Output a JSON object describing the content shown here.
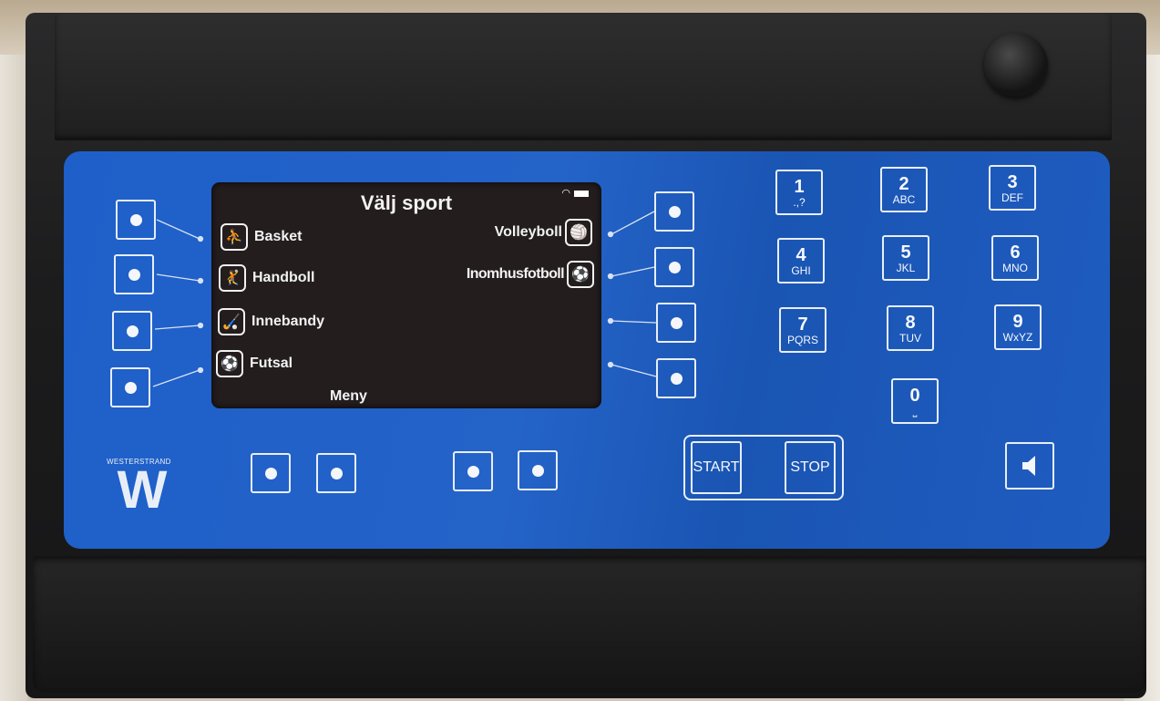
{
  "screen": {
    "title": "Välj sport",
    "left_sports": [
      {
        "label": "Basket",
        "icon": "basketball-player-icon"
      },
      {
        "label": "Handboll",
        "icon": "handball-player-icon"
      },
      {
        "label": "Innebandy",
        "icon": "floorball-player-icon"
      },
      {
        "label": "Futsal",
        "icon": "futsal-player-icon"
      }
    ],
    "right_sports": [
      {
        "label": "Volleyboll",
        "icon": "volleyball-player-icon"
      },
      {
        "label": "Inomhusfotboll",
        "icon": "indoor-football-player-icon"
      }
    ],
    "menu": "Meny"
  },
  "keypad": [
    {
      "digit": "1",
      "letters": ".,?"
    },
    {
      "digit": "2",
      "letters": "ABC"
    },
    {
      "digit": "3",
      "letters": "DEF"
    },
    {
      "digit": "4",
      "letters": "GHI"
    },
    {
      "digit": "5",
      "letters": "JKL"
    },
    {
      "digit": "6",
      "letters": "MNO"
    },
    {
      "digit": "7",
      "letters": "PQRS"
    },
    {
      "digit": "8",
      "letters": "TUV"
    },
    {
      "digit": "9",
      "letters": "WxYZ"
    },
    {
      "digit": "0",
      "letters": "⎵"
    }
  ],
  "controls": {
    "start": "START",
    "stop": "STOP"
  },
  "brand": {
    "name": "WESTERSTRAND",
    "logo_letter": "W"
  },
  "colors": {
    "panel": "#1f5ec6",
    "screen": "#231d1e",
    "body": "#1c1c1d"
  }
}
